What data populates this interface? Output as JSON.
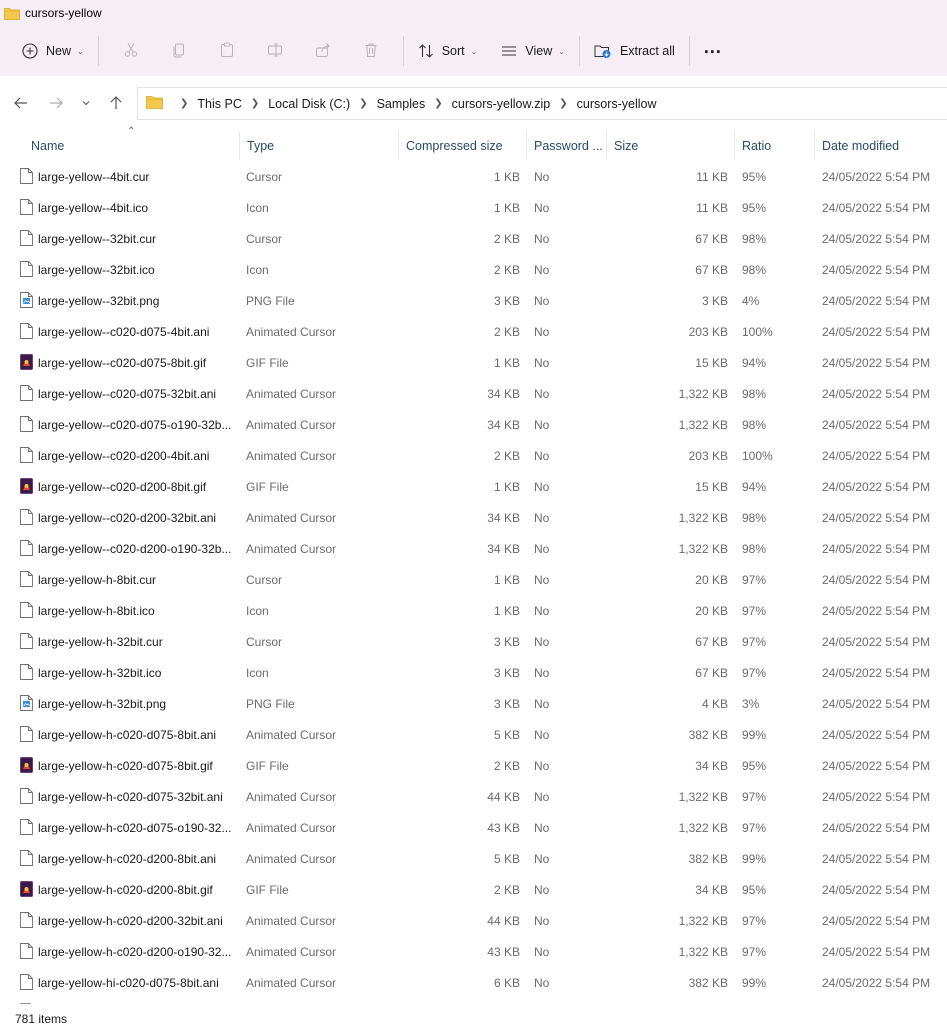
{
  "window": {
    "title": "cursors-yellow"
  },
  "toolbar": {
    "new_label": "New",
    "sort_label": "Sort",
    "view_label": "View",
    "extract_label": "Extract all",
    "more_label": "..."
  },
  "address": {
    "crumbs": [
      "This PC",
      "Local Disk (C:)",
      "Samples",
      "cursors-yellow.zip",
      "cursors-yellow"
    ]
  },
  "columns": {
    "name": "Name",
    "type": "Type",
    "compressed": "Compressed size",
    "password": "Password ...",
    "size": "Size",
    "ratio": "Ratio",
    "date": "Date modified"
  },
  "files": [
    {
      "name": "large-yellow--4bit.cur",
      "type": "Cursor",
      "compressed": "1 KB",
      "password": "No",
      "size": "11 KB",
      "ratio": "95%",
      "date": "24/05/2022 5:54 PM",
      "icon": "file-icon"
    },
    {
      "name": "large-yellow--4bit.ico",
      "type": "Icon",
      "compressed": "1 KB",
      "password": "No",
      "size": "11 KB",
      "ratio": "95%",
      "date": "24/05/2022 5:54 PM",
      "icon": "file-icon"
    },
    {
      "name": "large-yellow--32bit.cur",
      "type": "Cursor",
      "compressed": "2 KB",
      "password": "No",
      "size": "67 KB",
      "ratio": "98%",
      "date": "24/05/2022 5:54 PM",
      "icon": "file-icon"
    },
    {
      "name": "large-yellow--32bit.ico",
      "type": "Icon",
      "compressed": "2 KB",
      "password": "No",
      "size": "67 KB",
      "ratio": "98%",
      "date": "24/05/2022 5:54 PM",
      "icon": "file-icon"
    },
    {
      "name": "large-yellow--32bit.png",
      "type": "PNG File",
      "compressed": "3 KB",
      "password": "No",
      "size": "3 KB",
      "ratio": "4%",
      "date": "24/05/2022 5:54 PM",
      "icon": "png-file-icon"
    },
    {
      "name": "large-yellow--c020-d075-4bit.ani",
      "type": "Animated Cursor",
      "compressed": "2 KB",
      "password": "No",
      "size": "203 KB",
      "ratio": "100%",
      "date": "24/05/2022 5:54 PM",
      "icon": "file-icon"
    },
    {
      "name": "large-yellow--c020-d075-8bit.gif",
      "type": "GIF File",
      "compressed": "1 KB",
      "password": "No",
      "size": "15 KB",
      "ratio": "94%",
      "date": "24/05/2022 5:54 PM",
      "icon": "gif-file-icon"
    },
    {
      "name": "large-yellow--c020-d075-32bit.ani",
      "type": "Animated Cursor",
      "compressed": "34 KB",
      "password": "No",
      "size": "1,322 KB",
      "ratio": "98%",
      "date": "24/05/2022 5:54 PM",
      "icon": "file-icon"
    },
    {
      "name": "large-yellow--c020-d075-o190-32b...",
      "type": "Animated Cursor",
      "compressed": "34 KB",
      "password": "No",
      "size": "1,322 KB",
      "ratio": "98%",
      "date": "24/05/2022 5:54 PM",
      "icon": "file-icon"
    },
    {
      "name": "large-yellow--c020-d200-4bit.ani",
      "type": "Animated Cursor",
      "compressed": "2 KB",
      "password": "No",
      "size": "203 KB",
      "ratio": "100%",
      "date": "24/05/2022 5:54 PM",
      "icon": "file-icon"
    },
    {
      "name": "large-yellow--c020-d200-8bit.gif",
      "type": "GIF File",
      "compressed": "1 KB",
      "password": "No",
      "size": "15 KB",
      "ratio": "94%",
      "date": "24/05/2022 5:54 PM",
      "icon": "gif-file-icon"
    },
    {
      "name": "large-yellow--c020-d200-32bit.ani",
      "type": "Animated Cursor",
      "compressed": "34 KB",
      "password": "No",
      "size": "1,322 KB",
      "ratio": "98%",
      "date": "24/05/2022 5:54 PM",
      "icon": "file-icon"
    },
    {
      "name": "large-yellow--c020-d200-o190-32b...",
      "type": "Animated Cursor",
      "compressed": "34 KB",
      "password": "No",
      "size": "1,322 KB",
      "ratio": "98%",
      "date": "24/05/2022 5:54 PM",
      "icon": "file-icon"
    },
    {
      "name": "large-yellow-h-8bit.cur",
      "type": "Cursor",
      "compressed": "1 KB",
      "password": "No",
      "size": "20 KB",
      "ratio": "97%",
      "date": "24/05/2022 5:54 PM",
      "icon": "file-icon"
    },
    {
      "name": "large-yellow-h-8bit.ico",
      "type": "Icon",
      "compressed": "1 KB",
      "password": "No",
      "size": "20 KB",
      "ratio": "97%",
      "date": "24/05/2022 5:54 PM",
      "icon": "file-icon"
    },
    {
      "name": "large-yellow-h-32bit.cur",
      "type": "Cursor",
      "compressed": "3 KB",
      "password": "No",
      "size": "67 KB",
      "ratio": "97%",
      "date": "24/05/2022 5:54 PM",
      "icon": "file-icon"
    },
    {
      "name": "large-yellow-h-32bit.ico",
      "type": "Icon",
      "compressed": "3 KB",
      "password": "No",
      "size": "67 KB",
      "ratio": "97%",
      "date": "24/05/2022 5:54 PM",
      "icon": "file-icon"
    },
    {
      "name": "large-yellow-h-32bit.png",
      "type": "PNG File",
      "compressed": "3 KB",
      "password": "No",
      "size": "4 KB",
      "ratio": "3%",
      "date": "24/05/2022 5:54 PM",
      "icon": "png-file-icon"
    },
    {
      "name": "large-yellow-h-c020-d075-8bit.ani",
      "type": "Animated Cursor",
      "compressed": "5 KB",
      "password": "No",
      "size": "382 KB",
      "ratio": "99%",
      "date": "24/05/2022 5:54 PM",
      "icon": "file-icon"
    },
    {
      "name": "large-yellow-h-c020-d075-8bit.gif",
      "type": "GIF File",
      "compressed": "2 KB",
      "password": "No",
      "size": "34 KB",
      "ratio": "95%",
      "date": "24/05/2022 5:54 PM",
      "icon": "gif-file-icon"
    },
    {
      "name": "large-yellow-h-c020-d075-32bit.ani",
      "type": "Animated Cursor",
      "compressed": "44 KB",
      "password": "No",
      "size": "1,322 KB",
      "ratio": "97%",
      "date": "24/05/2022 5:54 PM",
      "icon": "file-icon"
    },
    {
      "name": "large-yellow-h-c020-d075-o190-32...",
      "type": "Animated Cursor",
      "compressed": "43 KB",
      "password": "No",
      "size": "1,322 KB",
      "ratio": "97%",
      "date": "24/05/2022 5:54 PM",
      "icon": "file-icon"
    },
    {
      "name": "large-yellow-h-c020-d200-8bit.ani",
      "type": "Animated Cursor",
      "compressed": "5 KB",
      "password": "No",
      "size": "382 KB",
      "ratio": "99%",
      "date": "24/05/2022 5:54 PM",
      "icon": "file-icon"
    },
    {
      "name": "large-yellow-h-c020-d200-8bit.gif",
      "type": "GIF File",
      "compressed": "2 KB",
      "password": "No",
      "size": "34 KB",
      "ratio": "95%",
      "date": "24/05/2022 5:54 PM",
      "icon": "gif-file-icon"
    },
    {
      "name": "large-yellow-h-c020-d200-32bit.ani",
      "type": "Animated Cursor",
      "compressed": "44 KB",
      "password": "No",
      "size": "1,322 KB",
      "ratio": "97%",
      "date": "24/05/2022 5:54 PM",
      "icon": "file-icon"
    },
    {
      "name": "large-yellow-h-c020-d200-o190-32...",
      "type": "Animated Cursor",
      "compressed": "43 KB",
      "password": "No",
      "size": "1,322 KB",
      "ratio": "97%",
      "date": "24/05/2022 5:54 PM",
      "icon": "file-icon"
    },
    {
      "name": "large-yellow-hi-c020-d075-8bit.ani",
      "type": "Animated Cursor",
      "compressed": "6 KB",
      "password": "No",
      "size": "382 KB",
      "ratio": "99%",
      "date": "24/05/2022 5:54 PM",
      "icon": "file-icon"
    }
  ],
  "status": {
    "item_count": "781 items"
  },
  "colors": {
    "toolbar_bg": "#f5eef5",
    "header_text": "#2b4a6b",
    "folder_yellow": "#f2c94c"
  }
}
